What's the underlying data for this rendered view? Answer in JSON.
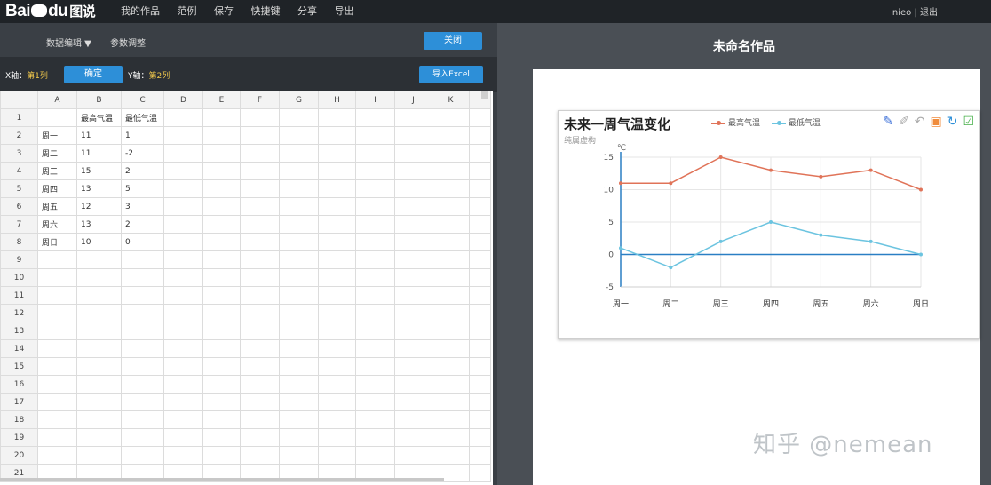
{
  "topbar": {
    "logo_text_left": "Bai",
    "logo_text_right": "du",
    "product": "图说",
    "nav": [
      "我的作品",
      "范例",
      "保存",
      "快捷键",
      "分享",
      "导出"
    ],
    "user": "nieo | 退出"
  },
  "editor": {
    "tab_data": "数据编辑 ▼",
    "tab_params": "参数调整",
    "close_label": "关闭",
    "x_label": "X轴：",
    "x_value": "第1列",
    "confirm_label": "确定",
    "y_label": "Y轴：",
    "y_value": "第2列",
    "import_label": "导入Excel"
  },
  "sheet": {
    "columns": [
      "A",
      "B",
      "C",
      "D",
      "E",
      "F",
      "G",
      "H",
      "I",
      "J",
      "K"
    ],
    "rows": [
      [
        "",
        "最高气温",
        "最低气温"
      ],
      [
        "周一",
        "11",
        "1"
      ],
      [
        "周二",
        "11",
        "-2"
      ],
      [
        "周三",
        "15",
        "2"
      ],
      [
        "周四",
        "13",
        "5"
      ],
      [
        "周五",
        "12",
        "3"
      ],
      [
        "周六",
        "13",
        "2"
      ],
      [
        "周日",
        "10",
        "0"
      ]
    ],
    "row_count": 21
  },
  "preview": {
    "work_title": "未命名作品"
  },
  "chart_data": {
    "type": "line",
    "title": "未来一周气温变化",
    "subtitle": "纯属虚构",
    "ylabel": "℃",
    "categories": [
      "周一",
      "周二",
      "周三",
      "周四",
      "周五",
      "周六",
      "周日"
    ],
    "series": [
      {
        "name": "最高气温",
        "values": [
          11,
          11,
          15,
          13,
          12,
          13,
          10
        ],
        "color": "#e07358"
      },
      {
        "name": "最低气温",
        "values": [
          1,
          -2,
          2,
          5,
          3,
          2,
          0
        ],
        "color": "#6cc4e0"
      }
    ],
    "yticks": [
      -5,
      0,
      5,
      10,
      15
    ],
    "ylim": [
      -5,
      15
    ],
    "grid": true,
    "legend": "top"
  },
  "watermark": "知乎 @nemean"
}
